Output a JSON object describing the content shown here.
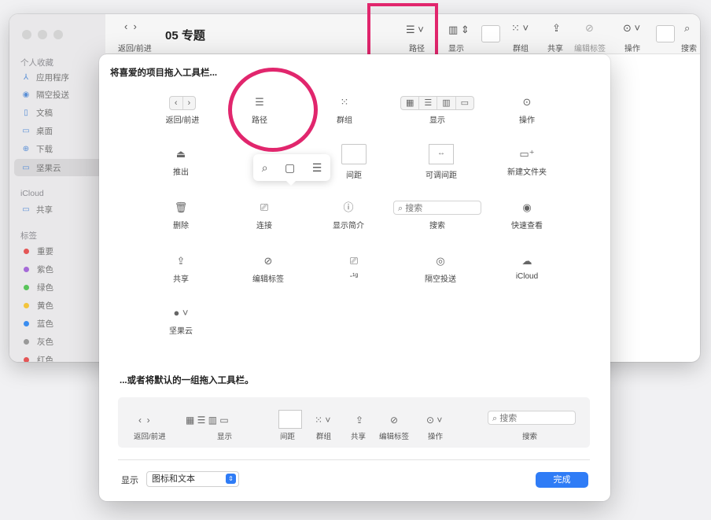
{
  "window": {
    "title": "05 专题",
    "sidebar": {
      "favorites_header": "个人收藏",
      "favorites": [
        {
          "icon": "apps-icon",
          "label": "应用程序"
        },
        {
          "icon": "airdrop-icon",
          "label": "隔空投送"
        },
        {
          "icon": "document-icon",
          "label": "文稿"
        },
        {
          "icon": "desktop-icon",
          "label": "桌面"
        },
        {
          "icon": "download-icon",
          "label": "下载"
        },
        {
          "icon": "folder-icon",
          "label": "坚果云"
        }
      ],
      "icloud_header": "iCloud",
      "icloud": [
        {
          "icon": "shared-folder-icon",
          "label": "共享"
        }
      ],
      "tags_header": "标签",
      "tags": [
        {
          "label": "重要",
          "color": "#e45656"
        },
        {
          "label": "紫色",
          "color": "#a56ad8"
        },
        {
          "label": "绿色",
          "color": "#59c45b"
        },
        {
          "label": "黄色",
          "color": "#f3c43c"
        },
        {
          "label": "蓝色",
          "color": "#3a8df0"
        },
        {
          "label": "灰色",
          "color": "#999999"
        },
        {
          "label": "红色",
          "color": "#e45656"
        }
      ]
    },
    "toolbar": {
      "back_forward": "返回/前进",
      "path": "路径",
      "view": "显示",
      "group": "群组",
      "share": "共享",
      "edit_tags": "编辑标签",
      "action": "操作",
      "search": "搜索"
    }
  },
  "sheet": {
    "title": "将喜爱的项目拖入工具栏...",
    "items": {
      "back_forward": "返回/前进",
      "path": "路径",
      "group": "群组",
      "view": "显示",
      "action": "操作",
      "eject": "推出",
      "space": "间距",
      "flexible_space": "可调间距",
      "new_folder": "新建文件夹",
      "delete": "删除",
      "connect": "连接",
      "get_info": "显示简介",
      "search": "搜索",
      "search_placeholder": "搜索",
      "quick_look": "快速查看",
      "share": "共享",
      "edit_tags": "编辑标签",
      "airdrop": "隔空投送",
      "icloud": "iCloud",
      "jianguoyun": "坚果云",
      "partial_label": "-¹ᵍ"
    },
    "default_title": "...或者将默认的一组拖入工具栏。",
    "default_set": {
      "back_forward": "返回/前进",
      "view": "显示",
      "space": "间距",
      "group": "群组",
      "share": "共享",
      "edit_tags": "编辑标签",
      "action": "操作",
      "search": "搜索",
      "search_placeholder": "搜索"
    },
    "show_label": "显示",
    "show_value": "图标和文本",
    "done": "完成"
  },
  "colors": {
    "highlight": "#e1266d",
    "accent": "#2f7cf6"
  }
}
